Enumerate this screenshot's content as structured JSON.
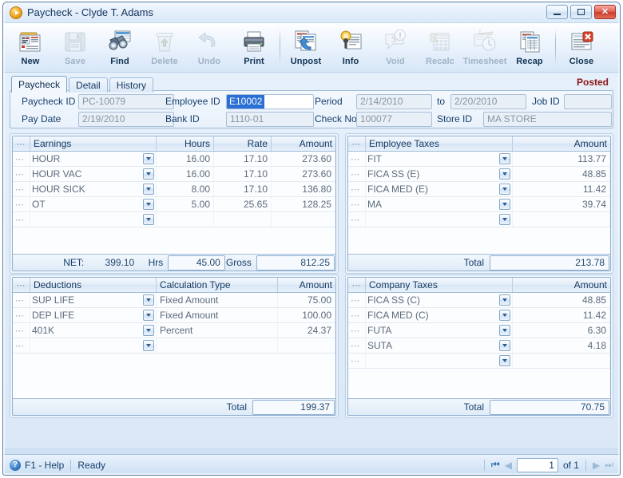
{
  "window": {
    "title": "Paycheck - Clyde T. Adams",
    "app_icon": "play-circle-icon",
    "buttons": {
      "minimize": "minimize-icon",
      "maximize": "maximize-icon",
      "close": "close-icon"
    }
  },
  "toolbar": {
    "items": [
      {
        "label": "New",
        "icon": "new-document-icon",
        "disabled": false
      },
      {
        "label": "Save",
        "icon": "floppy-disk-icon",
        "disabled": true
      },
      {
        "label": "Find",
        "icon": "binoculars-icon",
        "disabled": false
      },
      {
        "label": "Delete",
        "icon": "trash-can-icon",
        "disabled": true
      },
      {
        "label": "Undo",
        "icon": "undo-arrow-icon",
        "disabled": true
      },
      {
        "label": "Print",
        "icon": "printer-icon",
        "disabled": false
      },
      {
        "label": "Unpost",
        "icon": "unpost-icon",
        "disabled": false
      },
      {
        "label": "Info",
        "icon": "info-person-icon",
        "disabled": false
      },
      {
        "label": "Void",
        "icon": "void-dollar-icon",
        "disabled": true
      },
      {
        "label": "Recalc",
        "icon": "calculator-icon",
        "disabled": true
      },
      {
        "label": "Timesheet",
        "icon": "timesheet-clock-icon",
        "disabled": true
      },
      {
        "label": "Recap",
        "icon": "recap-report-icon",
        "disabled": false
      },
      {
        "label": "Close",
        "icon": "close-window-icon",
        "disabled": false
      }
    ],
    "separator_after": [
      5,
      11
    ]
  },
  "tabs": [
    {
      "label": "Paycheck",
      "active": true
    },
    {
      "label": "Detail",
      "active": false
    },
    {
      "label": "History",
      "active": false
    }
  ],
  "status_flag": "Posted",
  "form": {
    "paycheck_id": {
      "label": "Paycheck ID",
      "value": "PC-10079"
    },
    "pay_date": {
      "label": "Pay Date",
      "value": "2/19/2010"
    },
    "employee_id": {
      "label": "Employee ID",
      "value": "E10002",
      "selected": true
    },
    "bank_id": {
      "label": "Bank ID",
      "value": "1110-01"
    },
    "period": {
      "label": "Period",
      "value": "2/14/2010"
    },
    "period_to": {
      "label": "to",
      "value": "2/20/2010"
    },
    "check_no": {
      "label": "Check No",
      "value": "100077"
    },
    "store_id": {
      "label": "Store ID",
      "value": "MA STORE"
    },
    "job_id": {
      "label": "Job ID",
      "value": ""
    }
  },
  "earnings": {
    "columns": [
      "Earnings",
      "Hours",
      "Rate",
      "Amount"
    ],
    "rows": [
      {
        "name": "HOUR",
        "hours": "16.00",
        "rate": "17.10",
        "amount": "273.60"
      },
      {
        "name": "HOUR VAC",
        "hours": "16.00",
        "rate": "17.10",
        "amount": "273.60"
      },
      {
        "name": "HOUR SICK",
        "hours": "8.00",
        "rate": "17.10",
        "amount": "136.80"
      },
      {
        "name": "OT",
        "hours": "5.00",
        "rate": "25.65",
        "amount": "128.25"
      },
      {
        "name": "",
        "hours": "",
        "rate": "",
        "amount": ""
      }
    ],
    "footer": {
      "net_label": "NET:",
      "net_value": "399.10",
      "hrs_label": "Hrs",
      "hrs_value": "45.00",
      "gross_label": "Gross",
      "gross_value": "812.25"
    }
  },
  "employee_taxes": {
    "columns": [
      "Employee Taxes",
      "Amount"
    ],
    "rows": [
      {
        "name": "FIT",
        "amount": "113.77"
      },
      {
        "name": "FICA SS (E)",
        "amount": "48.85"
      },
      {
        "name": "FICA MED (E)",
        "amount": "11.42"
      },
      {
        "name": "MA",
        "amount": "39.74"
      },
      {
        "name": "",
        "amount": ""
      }
    ],
    "footer": {
      "total_label": "Total",
      "total_value": "213.78"
    }
  },
  "deductions": {
    "columns": [
      "Deductions",
      "Calculation Type",
      "Amount"
    ],
    "rows": [
      {
        "name": "SUP LIFE",
        "calc": "Fixed Amount",
        "amount": "75.00"
      },
      {
        "name": "DEP LIFE",
        "calc": "Fixed Amount",
        "amount": "100.00"
      },
      {
        "name": "401K",
        "calc": "Percent",
        "amount": "24.37"
      },
      {
        "name": "",
        "calc": "",
        "amount": ""
      }
    ],
    "footer": {
      "total_label": "Total",
      "total_value": "199.37"
    }
  },
  "company_taxes": {
    "columns": [
      "Company Taxes",
      "Amount"
    ],
    "rows": [
      {
        "name": "FICA SS (C)",
        "amount": "48.85"
      },
      {
        "name": "FICA MED (C)",
        "amount": "11.42"
      },
      {
        "name": "FUTA",
        "amount": "6.30"
      },
      {
        "name": "SUTA",
        "amount": "4.18"
      },
      {
        "name": "",
        "amount": ""
      }
    ],
    "footer": {
      "total_label": "Total",
      "total_value": "70.75"
    }
  },
  "statusbar": {
    "help_icon": "help-circle-icon",
    "help_label": "F1 - Help",
    "state": "Ready",
    "nav": {
      "first": "first-record-icon",
      "prev": "previous-record-icon",
      "page": "1",
      "of_label": "of 1",
      "next": "next-record-icon",
      "last": "last-record-icon"
    }
  },
  "colors": {
    "accent": "#2a6fd4",
    "posted": "#8c1414",
    "label": "#16406c",
    "grid_border": "#8fb0d0",
    "close_button": "#cc3a28"
  }
}
